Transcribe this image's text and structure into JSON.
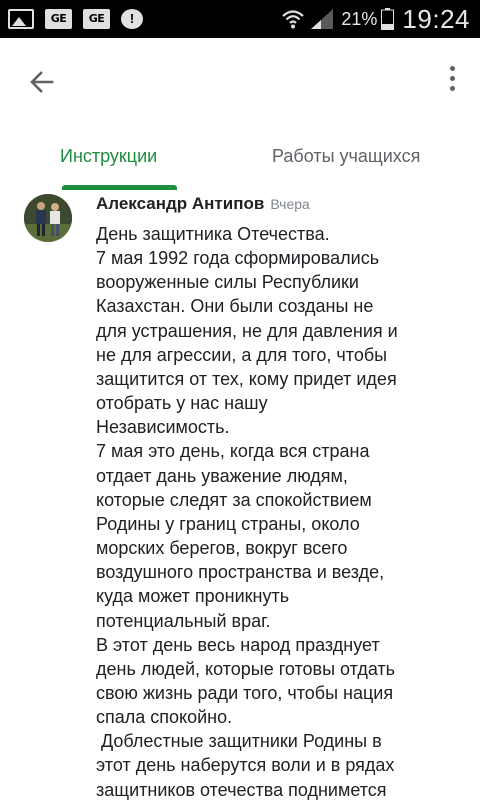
{
  "status_bar": {
    "battery_percent": "21%",
    "time": "19:24",
    "icons": [
      "image-icon",
      "ge-icon",
      "ge-icon",
      "chat-icon",
      "wifi-icon",
      "signal-icon",
      "battery-icon"
    ],
    "ge_label": "GE",
    "chat_label": "!"
  },
  "appbar": {
    "back_icon": "arrow-back-icon",
    "more_icon": "more-vert-icon"
  },
  "tabs": [
    {
      "label": "Инструкции",
      "active": true
    },
    {
      "label": "Работы учащихся",
      "active": false
    }
  ],
  "colors": {
    "accent": "#1e8e3e",
    "inactive_tab": "#5f6368",
    "status_bar": "#000000"
  },
  "comment": {
    "author": "Александр Антипов",
    "timestamp": "Вчера",
    "lines": [
      "День защитника Отечества.",
      "7 мая 1992 года сформировались",
      "вооруженные силы Республики",
      "Казахстан. Они были созданы не",
      "для устрашения, не для давления и",
      "не для агрессии, а для того, чтобы",
      "защитится от тех, кому придет идея",
      "отобрать у нас нашу",
      "Независимость.",
      "7 мая это день, когда вся страна",
      "отдает дань уважение людям,",
      "которые следят за спокойствием",
      "Родины у границ страны, около",
      "морских берегов, вокруг всего",
      "воздушного пространства и везде,",
      "куда может проникнуть",
      "потенциальный враг.",
      "В этот день весь народ празднует",
      "день людей, которые готовы отдать",
      "свою жизнь ради того, чтобы нация",
      "спала спокойно.",
      " Доблестные защитники Родины в",
      "этот день наберутся воли и в рядах",
      "защитников отечества поднимется"
    ]
  }
}
